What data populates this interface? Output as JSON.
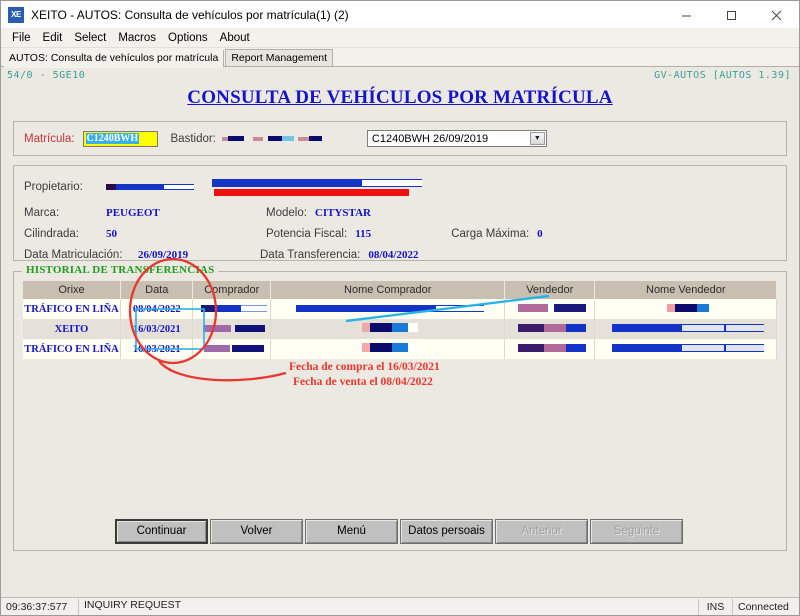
{
  "window": {
    "icon_text": "XE",
    "title": "XEITO - AUTOS: Consulta de vehículos por matrícula(1) (2)",
    "minimize": "minimize-icon",
    "maximize": "maximize-icon",
    "close": "close-icon"
  },
  "menubar": {
    "items": [
      "File",
      "Edit",
      "Select",
      "Macros",
      "Options",
      "About"
    ]
  },
  "tabs": [
    {
      "label": "AUTOS: Consulta de vehículos por matrícula",
      "active": true
    },
    {
      "label": "Report Management",
      "active": false
    }
  ],
  "header": {
    "left_status": "54/0 - 5GE10",
    "right_status": "GV-AUTOS [AUTOS 1.39]",
    "page_title": "CONSULTA DE VEHÍCULOS POR MATRÍCULA"
  },
  "plate_panel": {
    "matricula_label": "Matrícula:",
    "matricula_value": "C1240BWH",
    "bastidor_label": "Bastidor:",
    "bastidor_value": "",
    "combo_value": "C1240BWH 26/09/2019"
  },
  "vehicle_panel": {
    "propietario_label": "Propietario:",
    "marca_label": "Marca:",
    "marca_value": "PEUGEOT",
    "modelo_label": "Modelo:",
    "modelo_value": "CITYSTAR",
    "cilindrada_label": "Cilindrada:",
    "cilindrada_value": "50",
    "potencia_label": "Potencia Fiscal:",
    "potencia_value": "115",
    "carga_label": "Carga Máxima:",
    "carga_value": "0",
    "matriculacion_label": "Data Matriculación:",
    "matriculacion_value": "26/09/2019",
    "transferencia_label": "Data Transferencia:",
    "transferencia_value": "08/04/2022"
  },
  "historial": {
    "legend": "HISTORIAL DE TRANSFERENCIAS",
    "columns": [
      "Orixe",
      "Data",
      "Comprador",
      "Nome Comprador",
      "Vendedor",
      "Nome Vendedor"
    ],
    "rows": [
      {
        "orixe": "TRÁFICO EN LIÑA",
        "data": "08/04/2022",
        "comprador": "",
        "nome_comprador": "",
        "vendedor": "",
        "nome_vendedor": ""
      },
      {
        "orixe": "XEITO",
        "data": "16/03/2021",
        "comprador": "",
        "nome_comprador": "",
        "vendedor": "",
        "nome_vendedor": ""
      },
      {
        "orixe": "TRÁFICO EN LIÑA",
        "data": "16/03/2021",
        "comprador": "",
        "nome_comprador": "",
        "vendedor": "",
        "nome_vendedor": ""
      }
    ]
  },
  "annotations": {
    "line1": "Fecha de compra el 16/03/2021",
    "line2": "Fecha de venta el 08/04/2022",
    "color": "#e8372e",
    "pointer_color": "#29b3e8"
  },
  "buttons": [
    {
      "label": "Continuar",
      "state": "default"
    },
    {
      "label": "Volver",
      "state": "normal"
    },
    {
      "label": "Menú",
      "state": "normal"
    },
    {
      "label": "Datos persoais",
      "state": "normal"
    },
    {
      "label": "Anterior",
      "state": "disabled"
    },
    {
      "label": "Seguinte",
      "state": "disabled"
    }
  ],
  "statusbar": {
    "time": "09:36:37:577",
    "message": "INQUIRY REQUEST",
    "ins": "INS",
    "connection": "Connected"
  }
}
